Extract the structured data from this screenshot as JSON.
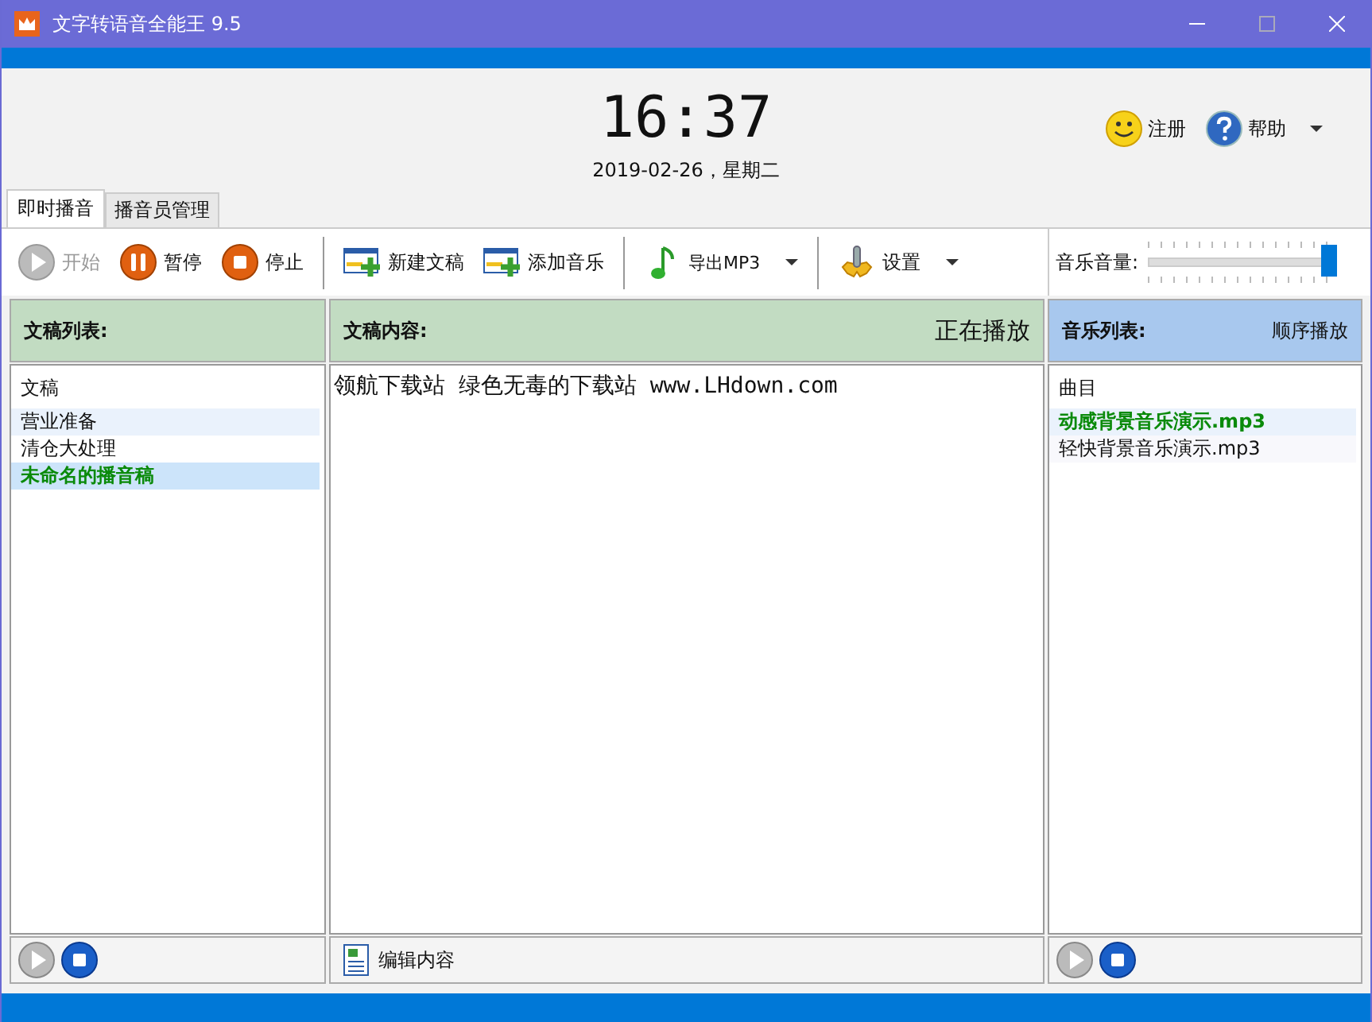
{
  "window": {
    "title": "文字转语音全能王 9.5"
  },
  "clock": {
    "time": "16:37",
    "date": "2019-02-26，星期二"
  },
  "header_buttons": [
    {
      "label": "注册",
      "dropdown": false
    },
    {
      "label": "帮助",
      "dropdown": true
    }
  ],
  "tabs": [
    {
      "label": "即时播音",
      "selected": true
    },
    {
      "label": "播音员管理",
      "selected": false
    }
  ],
  "toolbar": [
    {
      "kind": "button",
      "label": "开始",
      "disabled": true
    },
    {
      "kind": "button",
      "label": "暂停",
      "disabled": false
    },
    {
      "kind": "button",
      "label": "停止",
      "disabled": false
    },
    {
      "kind": "separator"
    },
    {
      "kind": "button",
      "label": "新建文稿",
      "disabled": false
    },
    {
      "kind": "button",
      "label": "添加音乐",
      "disabled": false
    },
    {
      "kind": "separator"
    },
    {
      "kind": "menu",
      "label": "导出MP3",
      "disabled": false
    },
    {
      "kind": "separator"
    },
    {
      "kind": "menu",
      "label": "设置",
      "disabled": false
    }
  ],
  "volume": {
    "label": "音乐音量:",
    "level": 1
  },
  "script_list": {
    "title": "文稿列表:",
    "column": "文稿",
    "items": [
      {
        "name": "营业准备",
        "selected": false,
        "playing": false
      },
      {
        "name": "清仓大处理",
        "selected": false,
        "playing": false
      },
      {
        "name": "未命名的播音稿",
        "selected": true,
        "playing": true
      }
    ]
  },
  "content": {
    "title": "文稿内容:",
    "status": "正在播放",
    "text": "领航下载站 绿色无毒的下载站 www.LHdown.com",
    "edit_button": "编辑内容"
  },
  "music_list": {
    "title": "音乐列表:",
    "mode": "顺序播放",
    "column": "曲目",
    "items": [
      {
        "name": "动感背景音乐演示.mp3",
        "selected": false,
        "playing": true
      },
      {
        "name": "轻快背景音乐演示.mp3",
        "selected": false,
        "playing": false
      }
    ]
  }
}
